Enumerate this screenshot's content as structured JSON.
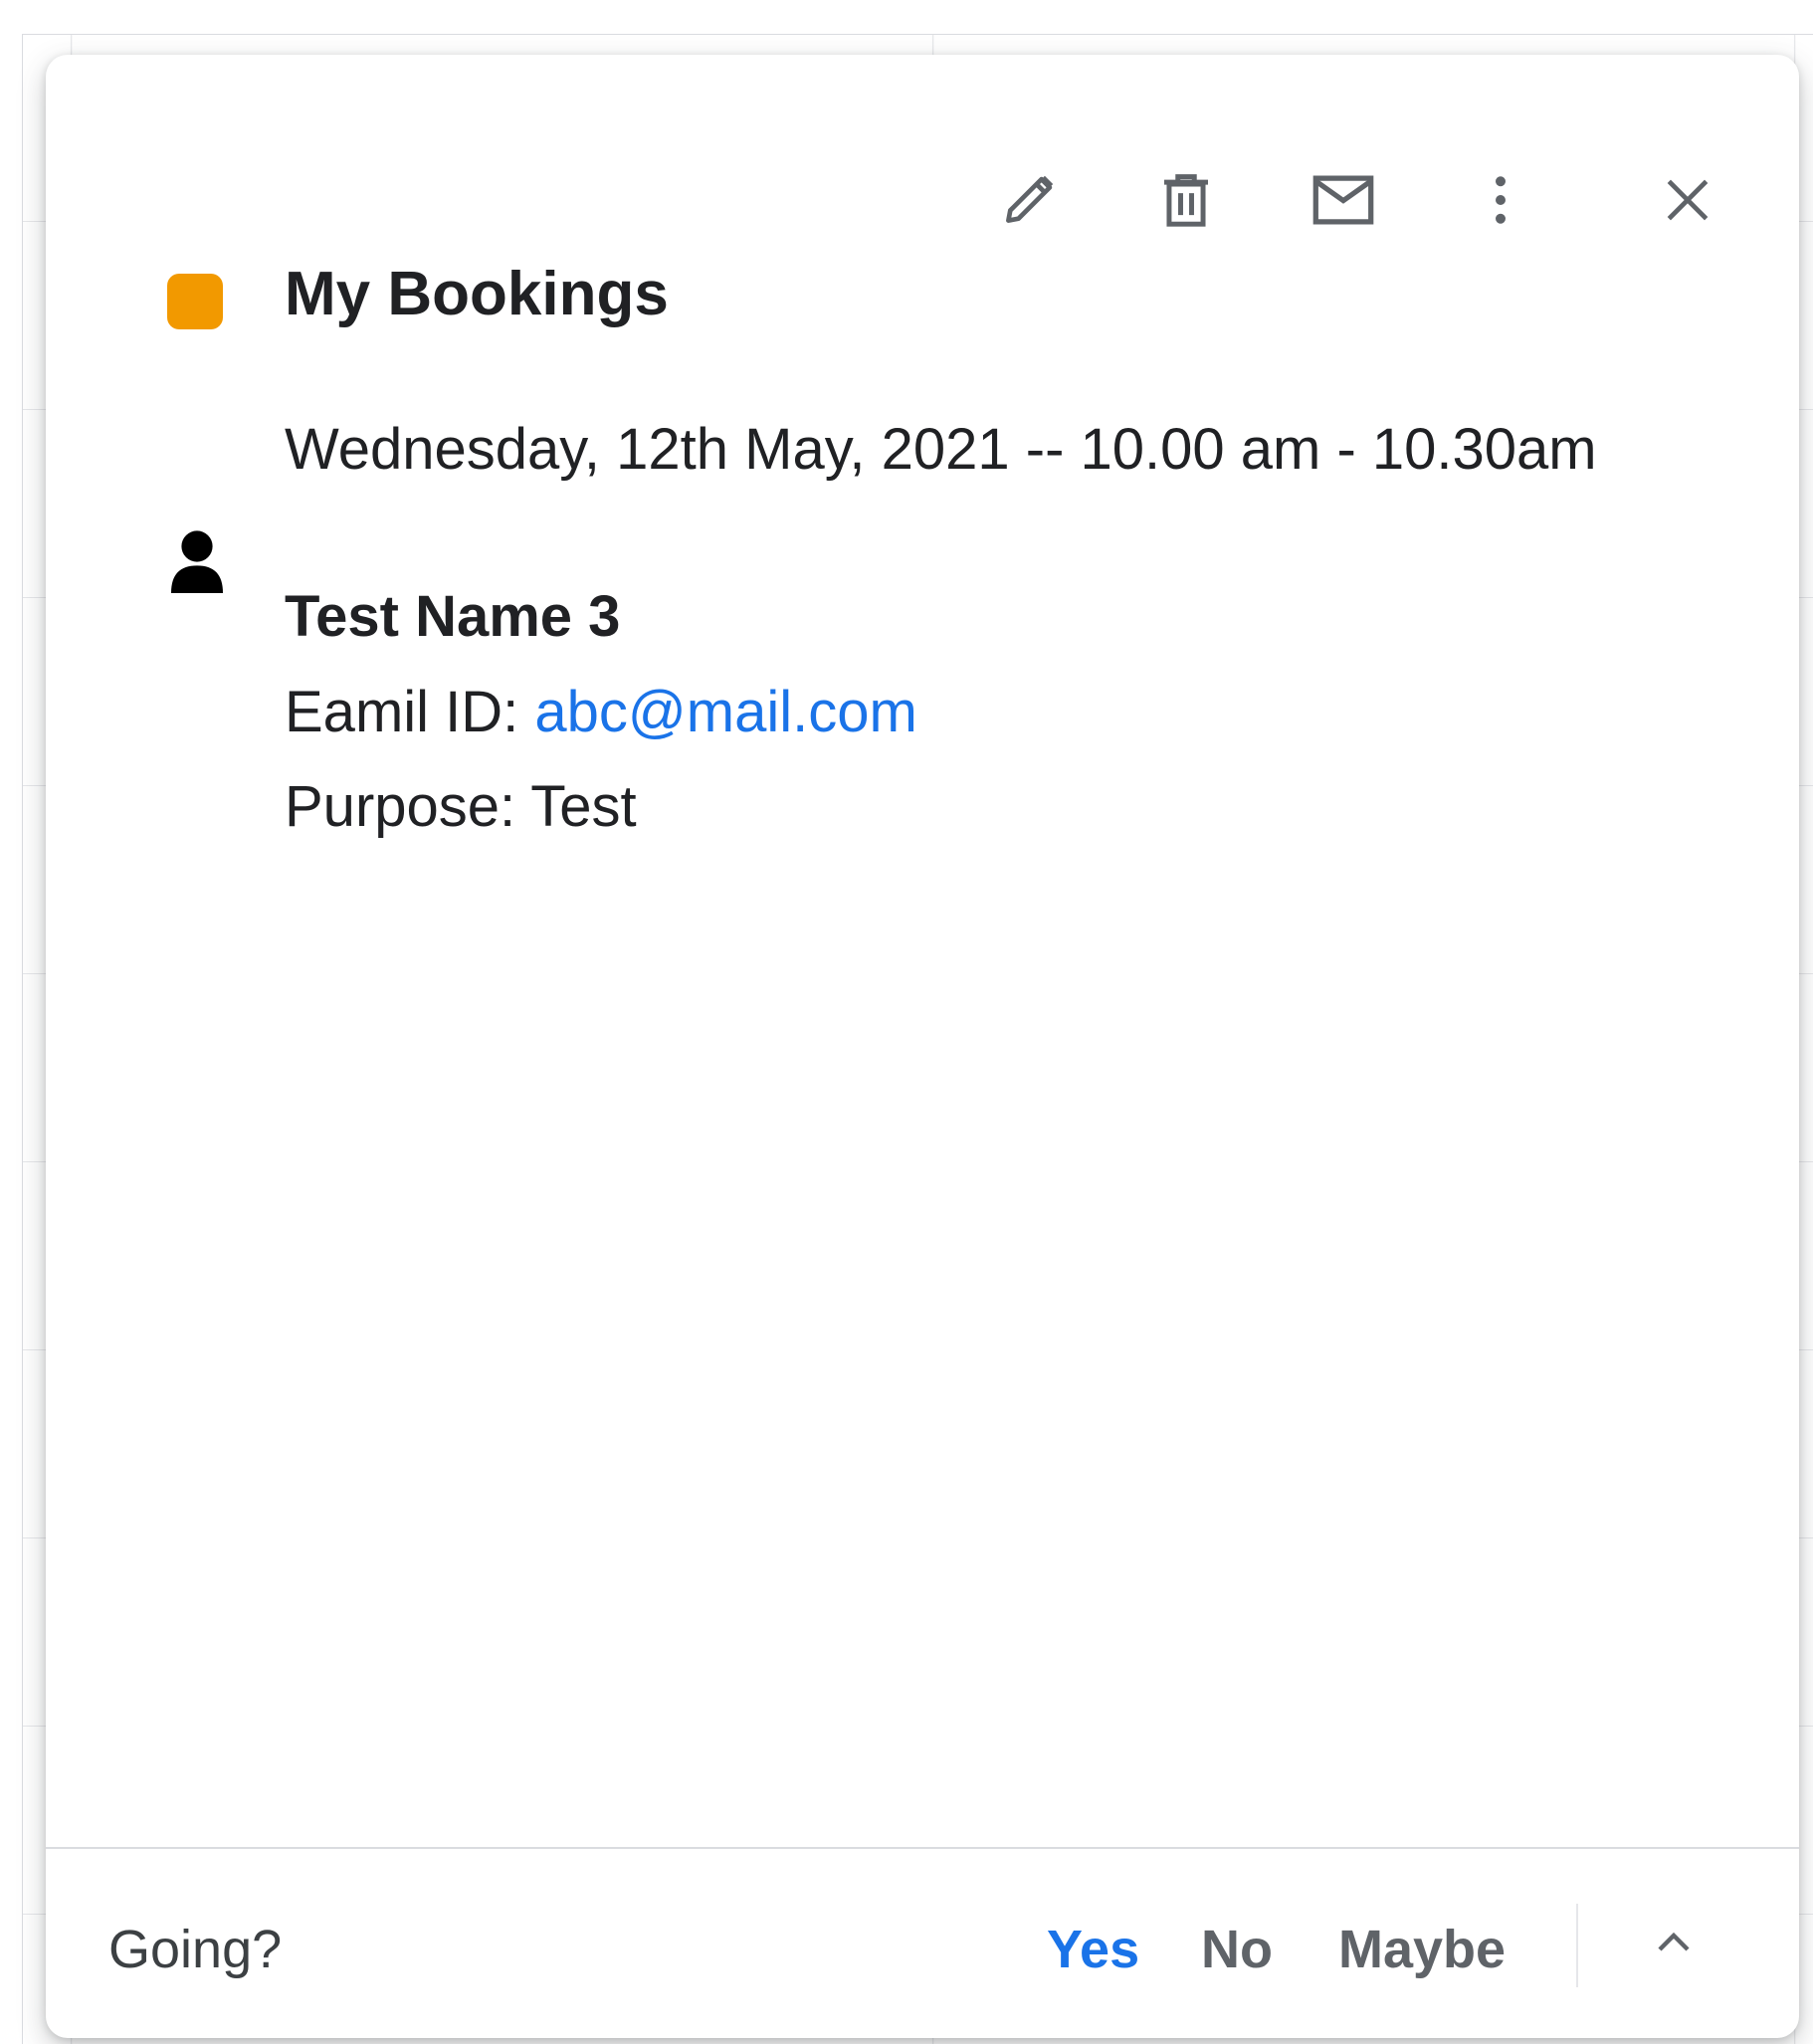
{
  "event": {
    "calendar_name": "My Bookings",
    "calendar_color": "#f29900",
    "datetime": "Wednesday, 12th May, 2021 -- 10.00 am - 10.30am"
  },
  "guest": {
    "name": "Test Name 3",
    "email_label": "Eamil ID: ",
    "email": "abc@mail.com",
    "purpose_label": "Purpose: ",
    "purpose": "Test"
  },
  "toolbar": {
    "edit_icon": "pencil-icon",
    "delete_icon": "trash-icon",
    "email_icon": "envelope-icon",
    "more_icon": "more-vertical-icon",
    "close_icon": "close-icon"
  },
  "footer": {
    "going_label": "Going?",
    "yes_label": "Yes",
    "no_label": "No",
    "maybe_label": "Maybe",
    "selected": "Yes",
    "expand_icon": "chevron-up-icon"
  },
  "colors": {
    "accent": "#1a73e8",
    "text": "#202124",
    "icon": "#5f6368"
  }
}
